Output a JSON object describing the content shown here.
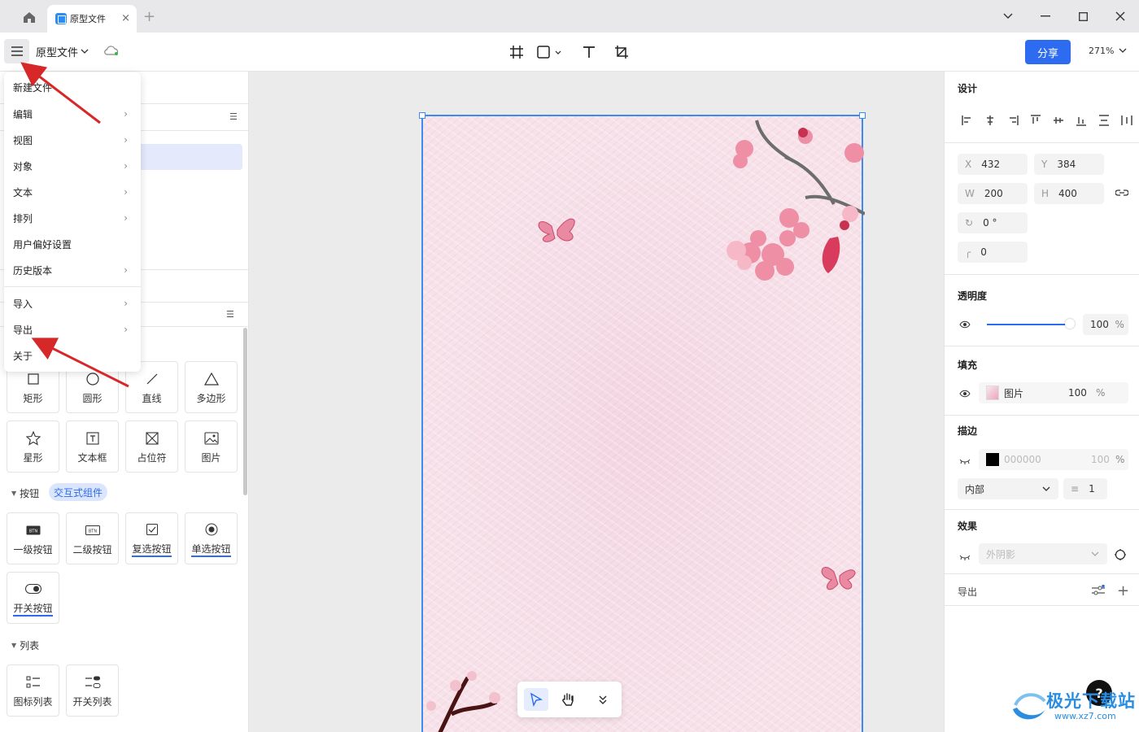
{
  "titlebar": {
    "tab_label": "原型文件",
    "tab_close": "×",
    "new_tab": "+"
  },
  "toolbar": {
    "doc_name": "原型文件",
    "share_label": "分享",
    "zoom_label": "271%"
  },
  "menu": {
    "items": [
      {
        "label": "新建文件",
        "has_submenu": false
      },
      {
        "label": "编辑",
        "has_submenu": true
      },
      {
        "label": "视图",
        "has_submenu": true
      },
      {
        "label": "对象",
        "has_submenu": true
      },
      {
        "label": "文本",
        "has_submenu": true
      },
      {
        "label": "排列",
        "has_submenu": true
      },
      {
        "label": "用户偏好设置",
        "has_submenu": false
      },
      {
        "label": "历史版本",
        "has_submenu": true
      },
      {
        "label": "导入",
        "has_submenu": true
      },
      {
        "label": "导出",
        "has_submenu": true
      },
      {
        "label": "关于",
        "has_submenu": false
      }
    ]
  },
  "library": {
    "shapes": [
      {
        "label": "矩形",
        "icon": "rectangle-icon"
      },
      {
        "label": "圆形",
        "icon": "circle-icon"
      },
      {
        "label": "直线",
        "icon": "line-icon"
      },
      {
        "label": "多边形",
        "icon": "polygon-icon"
      },
      {
        "label": "星形",
        "icon": "star-icon"
      },
      {
        "label": "文本框",
        "icon": "textbox-icon"
      },
      {
        "label": "占位符",
        "icon": "placeholder-icon"
      },
      {
        "label": "图片",
        "icon": "image-icon"
      }
    ],
    "buttons_section": "按钮",
    "buttons_chip": "交互式组件",
    "buttons": [
      {
        "label": "一级按钮",
        "icon": "btn-primary-icon"
      },
      {
        "label": "二级按钮",
        "icon": "btn-secondary-icon"
      },
      {
        "label": "复选按钮",
        "icon": "checkbox-icon"
      },
      {
        "label": "单选按钮",
        "icon": "radio-icon"
      },
      {
        "label": "开关按钮",
        "icon": "toggle-icon"
      }
    ],
    "list_section": "列表",
    "lists": [
      {
        "label": "图标列表",
        "icon": "icon-list-icon"
      },
      {
        "label": "开关列表",
        "icon": "switch-list-icon"
      }
    ]
  },
  "design": {
    "title": "设计",
    "x_label": "X",
    "x": "432",
    "y_label": "Y",
    "y": "384",
    "w_label": "W",
    "w": "200",
    "h_label": "H",
    "h": "400",
    "rotation": "0 °",
    "radius": "0",
    "opacity_title": "透明度",
    "opacity": "100",
    "percent": "%",
    "opacity_level": 1.0,
    "fill_title": "填充",
    "fill_type": "图片",
    "fill_opacity": "100",
    "stroke_title": "描边",
    "stroke_color": "000000",
    "stroke_opacity": "100",
    "stroke_position": "内部",
    "stroke_width": "1",
    "effects_title": "效果",
    "effect_type": "外阴影",
    "export_title": "导出"
  },
  "canvas": {
    "background_color": "#f6dfe8",
    "selection_color": "#3b8cf0"
  },
  "help_label": "?",
  "watermark": {
    "text": "极光下载站",
    "url": "www.xz7.com"
  },
  "colors": {
    "accent": "#2d6bf0",
    "annotation_arrow": "#d62828"
  }
}
